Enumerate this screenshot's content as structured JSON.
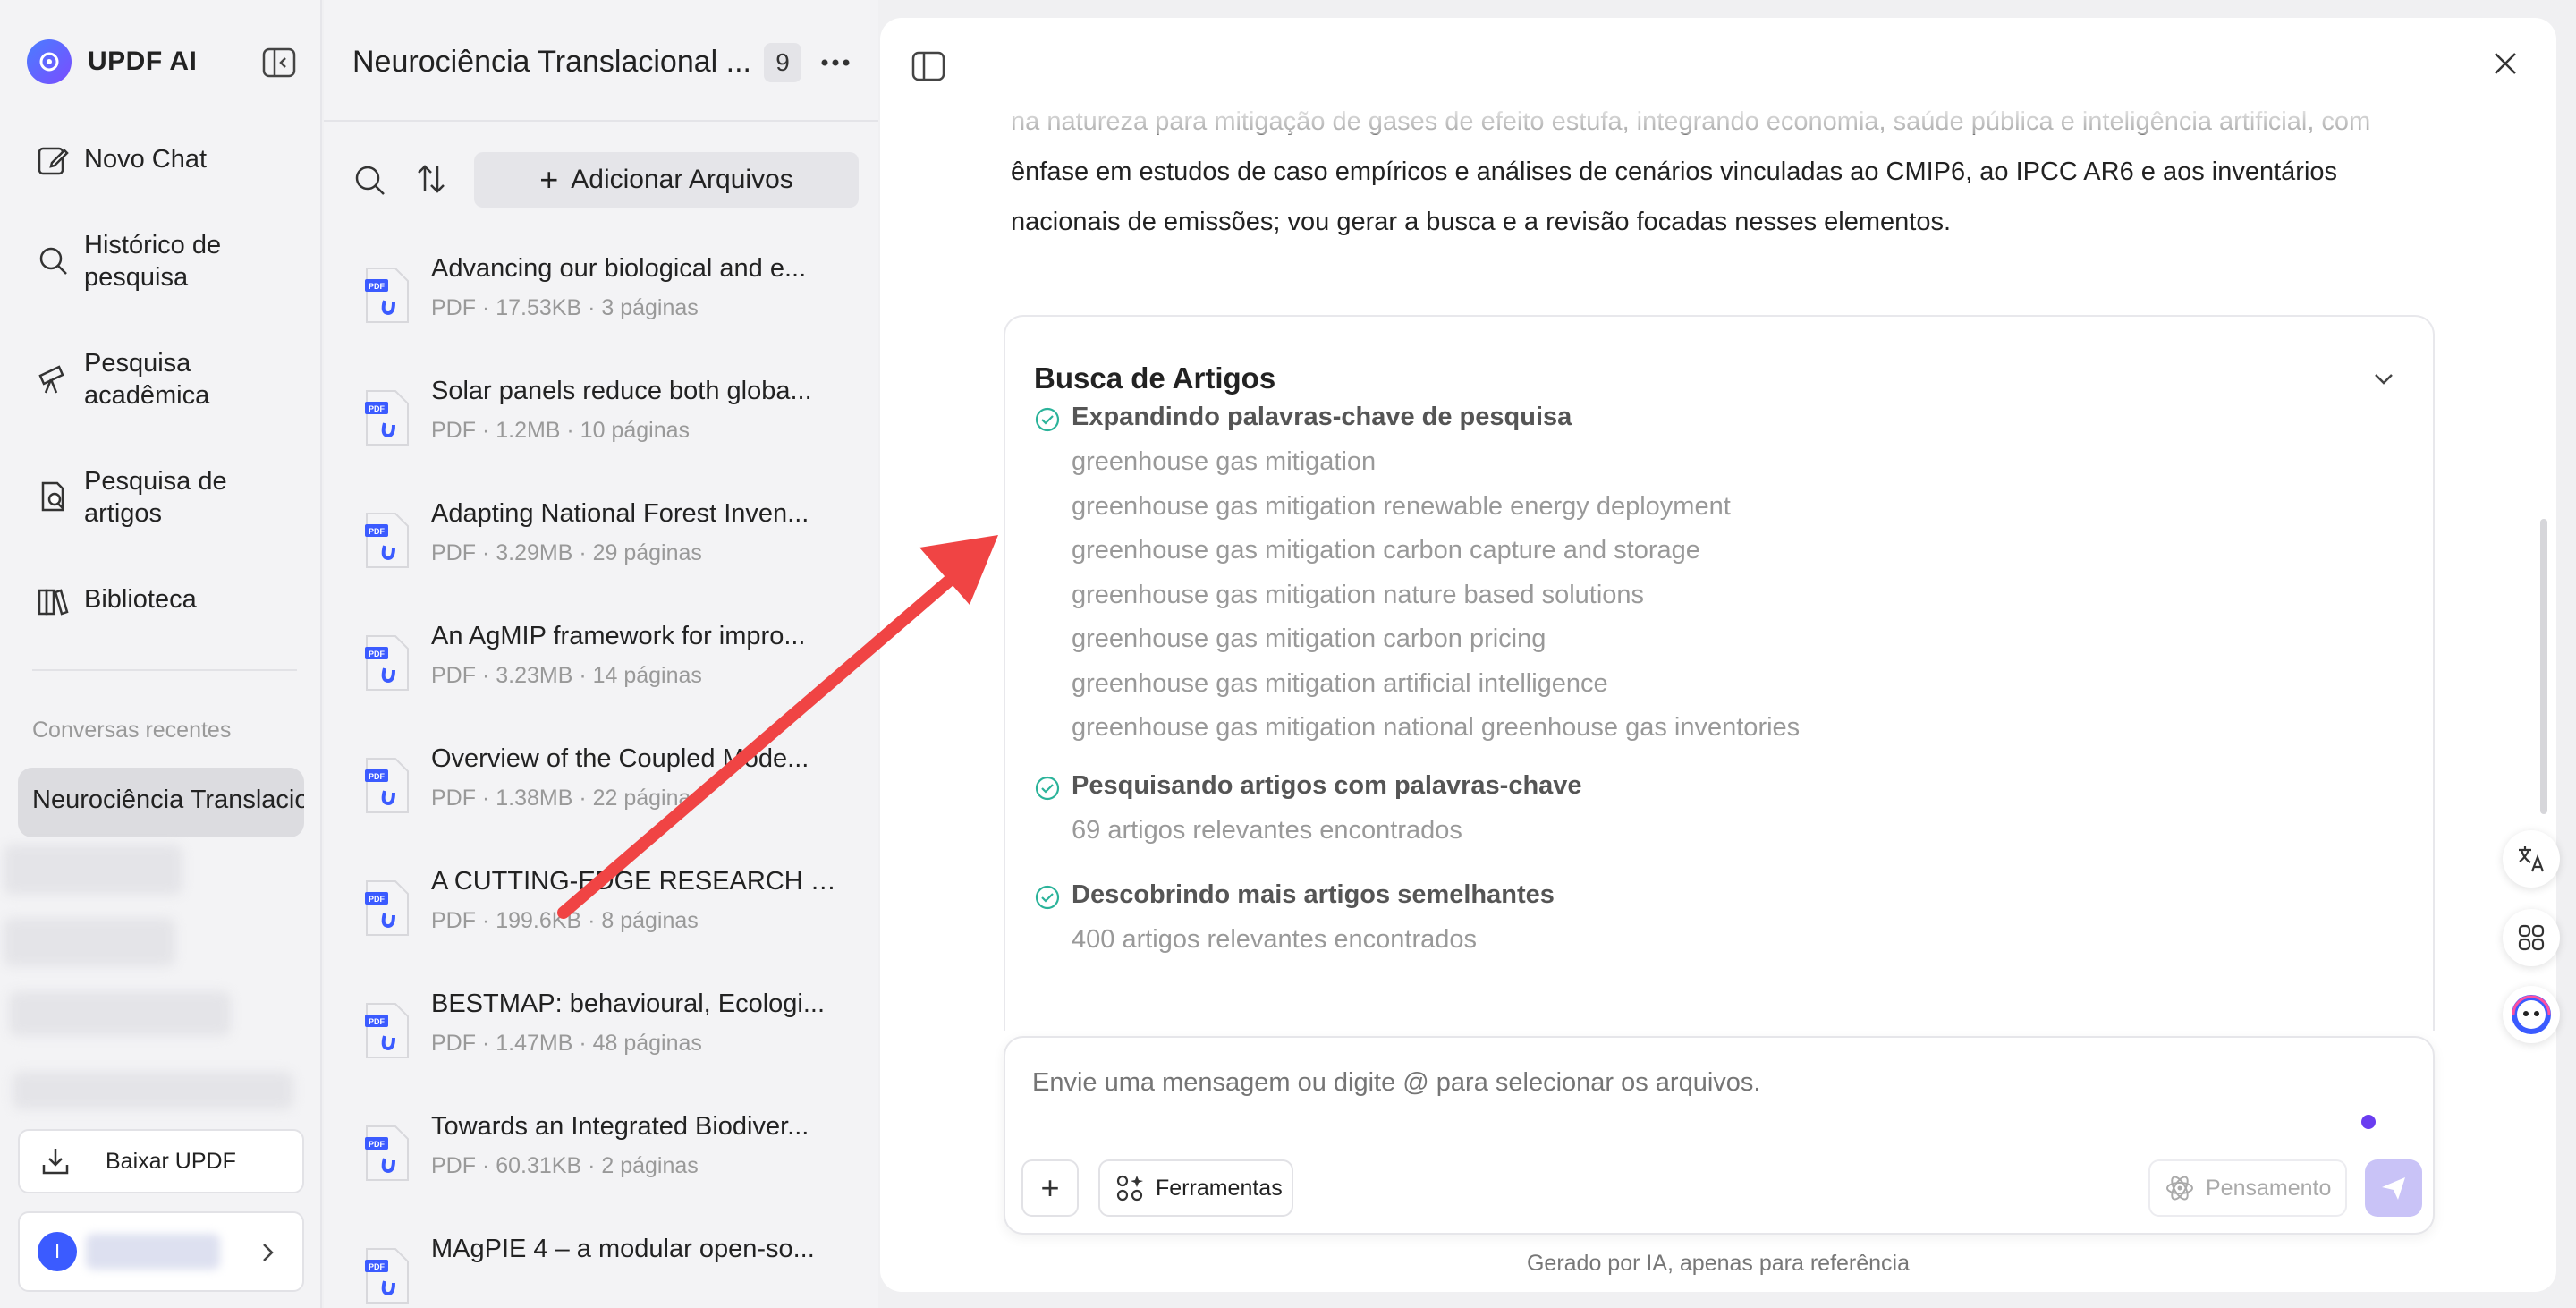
{
  "app": {
    "name": "UPDF AI"
  },
  "sidebar": {
    "nav": [
      {
        "label": "Novo Chat",
        "icon": "edit-icon"
      },
      {
        "label": "Histórico de pesquisa",
        "icon": "search-icon"
      },
      {
        "label": "Pesquisa acadêmica",
        "icon": "telescope-icon"
      },
      {
        "label": "Pesquisa de artigos",
        "icon": "document-search-icon"
      },
      {
        "label": "Biblioteca",
        "icon": "library-icon"
      }
    ],
    "recent_label": "Conversas recentes",
    "recent_active": "Neurociência Translacional ...",
    "download_label": "Baixar UPDF",
    "user_initial": "I"
  },
  "files_panel": {
    "title": "Neurociência Translacional ...",
    "count": "9",
    "add_label": "Adicionar Arquivos",
    "files": [
      {
        "name": "Advancing our biological and e...",
        "meta": "PDF · 17.53KB · 3 páginas"
      },
      {
        "name": "Solar panels reduce both globa...",
        "meta": "PDF · 1.2MB · 10 páginas"
      },
      {
        "name": "Adapting National Forest Inven...",
        "meta": "PDF · 3.29MB · 29 páginas"
      },
      {
        "name": "An AgMIP framework for impro...",
        "meta": "PDF · 3.23MB · 14 páginas"
      },
      {
        "name": "Overview of the Coupled Mode...",
        "meta": "PDF · 1.38MB · 22 páginas"
      },
      {
        "name": "A CUTTING-EDGE RESEARCH O...",
        "meta": "PDF · 199.6KB · 8 páginas"
      },
      {
        "name": "BESTMAP: behavioural, Ecologi...",
        "meta": "PDF · 1.47MB · 48 páginas"
      },
      {
        "name": "Towards an Integrated Biodiver...",
        "meta": "PDF · 60.31KB · 2 páginas"
      },
      {
        "name": "MAgPIE 4 – a modular open-so...",
        "meta": ""
      }
    ]
  },
  "chat": {
    "message_line1": "na natureza para mitigação de gases de efeito estufa, integrando economia, saúde pública e inteligência artificial, com",
    "message_line2": "ênfase em estudos de caso empíricos e análises de cenários vinculadas ao CMIP6, ao IPCC AR6 e aos inventários",
    "message_line3": "nacionais de emissões; vou gerar a busca e a revisão focadas nesses elementos.",
    "card_title": "Busca de Artigos",
    "steps": [
      {
        "title": "Expandindo palavras-chave de pesquisa",
        "lines": [
          "greenhouse gas mitigation",
          "greenhouse gas mitigation renewable energy deployment",
          "greenhouse gas mitigation carbon capture and storage",
          "greenhouse gas mitigation nature based solutions",
          "greenhouse gas mitigation carbon pricing",
          "greenhouse gas mitigation artificial intelligence",
          "greenhouse gas mitigation national greenhouse gas inventories"
        ]
      },
      {
        "title": "Pesquisando artigos com palavras-chave",
        "lines": [
          "69 artigos relevantes encontrados"
        ]
      },
      {
        "title": "Descobrindo mais artigos semelhantes",
        "lines": [
          "400 artigos relevantes encontrados"
        ]
      }
    ],
    "input_placeholder": "Envie uma mensagem ou digite @ para selecionar os arquivos.",
    "tools_label": "Ferramentas",
    "thinking_label": "Pensamento",
    "disclaimer": "Gerado por IA, apenas para referência"
  },
  "colors": {
    "accent": "#6a3df0",
    "check_green": "#2bb39a",
    "arrow_red": "#f04444",
    "pdf_blue": "#3b5bff"
  }
}
